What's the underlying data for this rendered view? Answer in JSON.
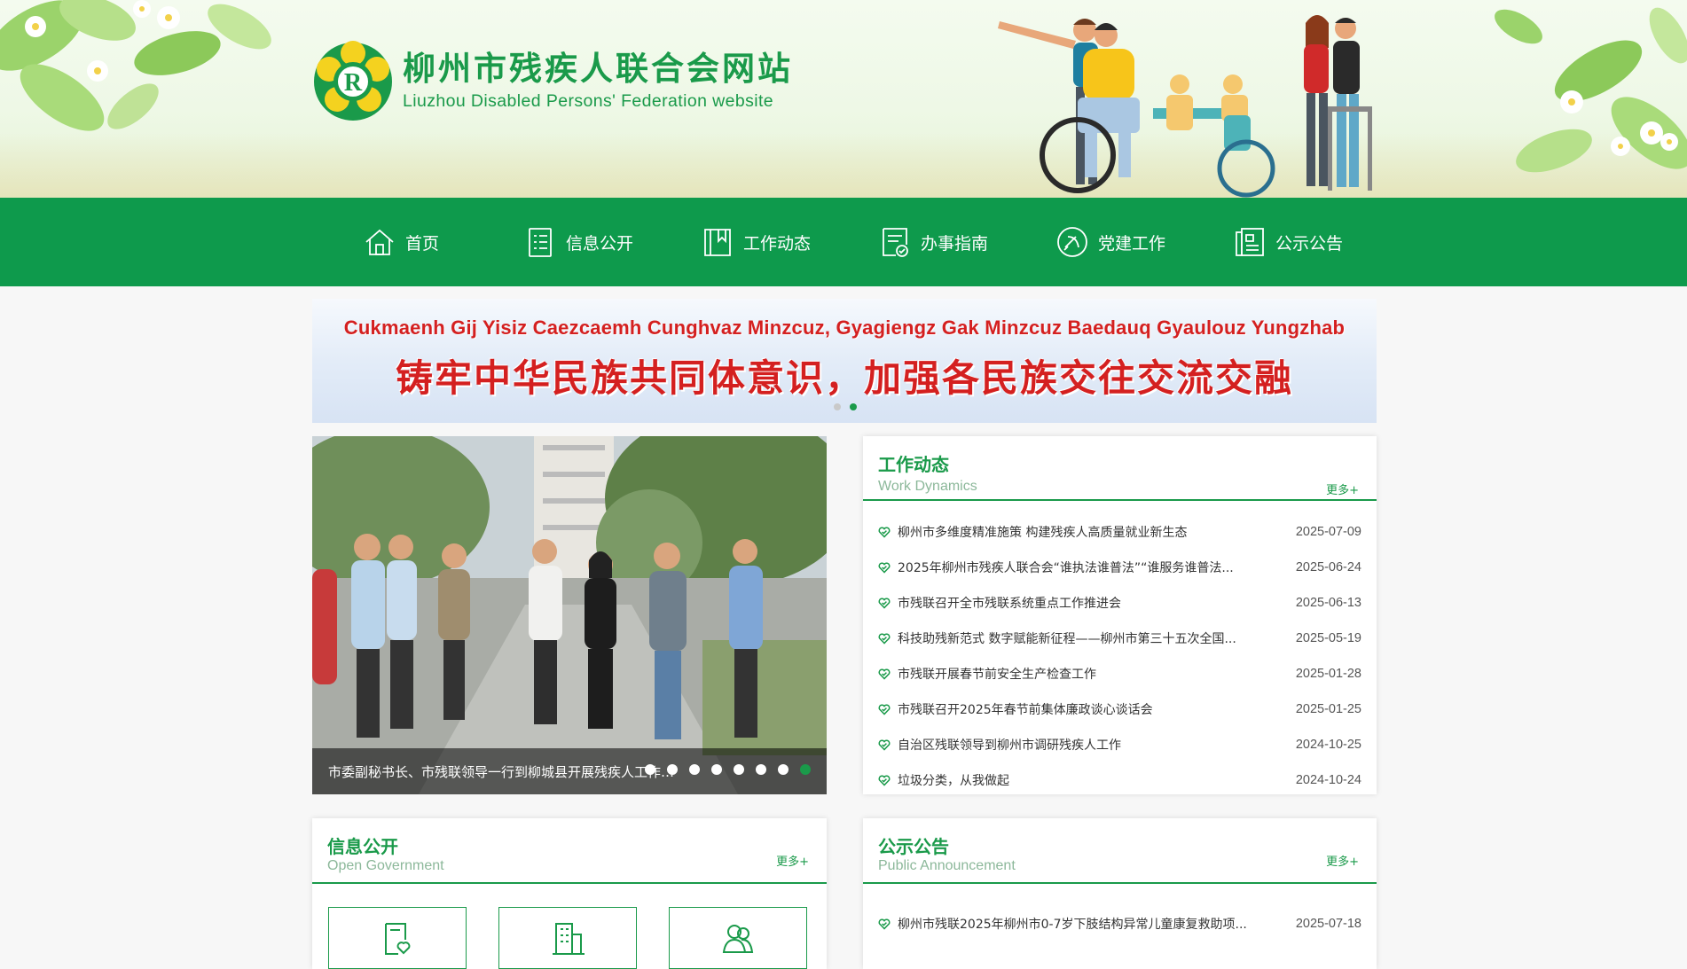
{
  "site": {
    "title_cn": "柳州市残疾人联合会网站",
    "title_en": "Liuzhou Disabled Persons' Federation website"
  },
  "nav": [
    {
      "label": "首页",
      "icon": "home-icon"
    },
    {
      "label": "信息公开",
      "icon": "list-icon"
    },
    {
      "label": "工作动态",
      "icon": "book-icon"
    },
    {
      "label": "办事指南",
      "icon": "guide-icon"
    },
    {
      "label": "党建工作",
      "icon": "party-icon"
    },
    {
      "label": "公示公告",
      "icon": "notice-icon"
    }
  ],
  "banner": {
    "line1": "Cukmaenh Gij Yisiz Caezcaemh Cunghvaz Minzcuz, Gyagiengz Gak Minzcuz Baedauq Gyaulouz Yungzhab",
    "line2": "铸牢中华民族共同体意识，加强各民族交往交流交融"
  },
  "photo": {
    "caption": "市委副秘书长、市残联领导一行到柳城县开展残疾人工作调研"
  },
  "work_dynamics": {
    "title_cn": "工作动态",
    "title_en": "Work Dynamics",
    "more": "更多+",
    "items": [
      {
        "title": "柳州市多维度精准施策 构建残疾人高质量就业新生态",
        "date": "2025-07-09"
      },
      {
        "title": "2025年柳州市残疾人联合会“谁执法谁普法”“谁服务谁普法...",
        "date": "2025-06-24"
      },
      {
        "title": "市残联召开全市残联系统重点工作推进会",
        "date": "2025-06-13"
      },
      {
        "title": "科技助残新范式 数字赋能新征程——柳州市第三十五次全国...",
        "date": "2025-05-19"
      },
      {
        "title": "市残联开展春节前安全生产检查工作",
        "date": "2025-01-28"
      },
      {
        "title": "市残联召开2025年春节前集体廉政谈心谈话会",
        "date": "2025-01-25"
      },
      {
        "title": "自治区残联领导到柳州市调研残疾人工作",
        "date": "2024-10-25"
      },
      {
        "title": "垃圾分类，从我做起",
        "date": "2024-10-24"
      }
    ]
  },
  "open_gov": {
    "title_cn": "信息公开",
    "title_en": "Open Government",
    "more": "更多+",
    "tiles": [
      "doc-heart-icon",
      "building-icon",
      "people-icon"
    ]
  },
  "announcement": {
    "title_cn": "公示公告",
    "title_en": "Public Announcement",
    "more": "更多+",
    "items": [
      {
        "title": "柳州市残联2025年柳州市0-7岁下肢结构异常儿童康复救助项...",
        "date": "2025-07-18"
      }
    ]
  },
  "colors": {
    "brand_green": "#0e9a4c",
    "accent_red": "#d42020"
  }
}
